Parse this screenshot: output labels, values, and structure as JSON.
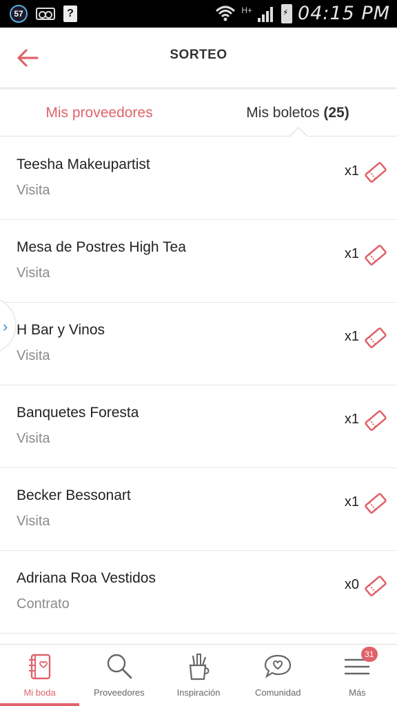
{
  "status_bar": {
    "badge": "57",
    "network": "H+",
    "time": "04:15 PM"
  },
  "header": {
    "title": "SORTEO",
    "back_icon": "arrow-left-icon",
    "accent_color": "#e0636b"
  },
  "tabs": [
    {
      "label": "Mis proveedores",
      "active": true
    },
    {
      "label": "Mis boletos",
      "count": "(25)",
      "active": false
    }
  ],
  "rows": [
    {
      "name": "Teesha Makeupartist",
      "type": "Visita",
      "count": "x1"
    },
    {
      "name": "Mesa de Postres High Tea",
      "type": "Visita",
      "count": "x1"
    },
    {
      "name": "H Bar y Vinos",
      "type": "Visita",
      "count": "x1"
    },
    {
      "name": "Banquetes Foresta",
      "type": "Visita",
      "count": "x1"
    },
    {
      "name": "Becker Bessonart",
      "type": "Visita",
      "count": "x1"
    },
    {
      "name": "Adriana Roa Vestidos",
      "type": "Contrato",
      "count": "x0"
    }
  ],
  "bottom_nav": [
    {
      "label": "Mi boda",
      "icon": "notebook-icon",
      "active": true
    },
    {
      "label": "Proveedores",
      "icon": "search-icon",
      "active": false
    },
    {
      "label": "Inspiración",
      "icon": "brush-cup-icon",
      "active": false
    },
    {
      "label": "Comunidad",
      "icon": "chat-heart-icon",
      "active": false
    },
    {
      "label": "Más",
      "icon": "menu-icon",
      "badge": "31",
      "active": false
    }
  ]
}
